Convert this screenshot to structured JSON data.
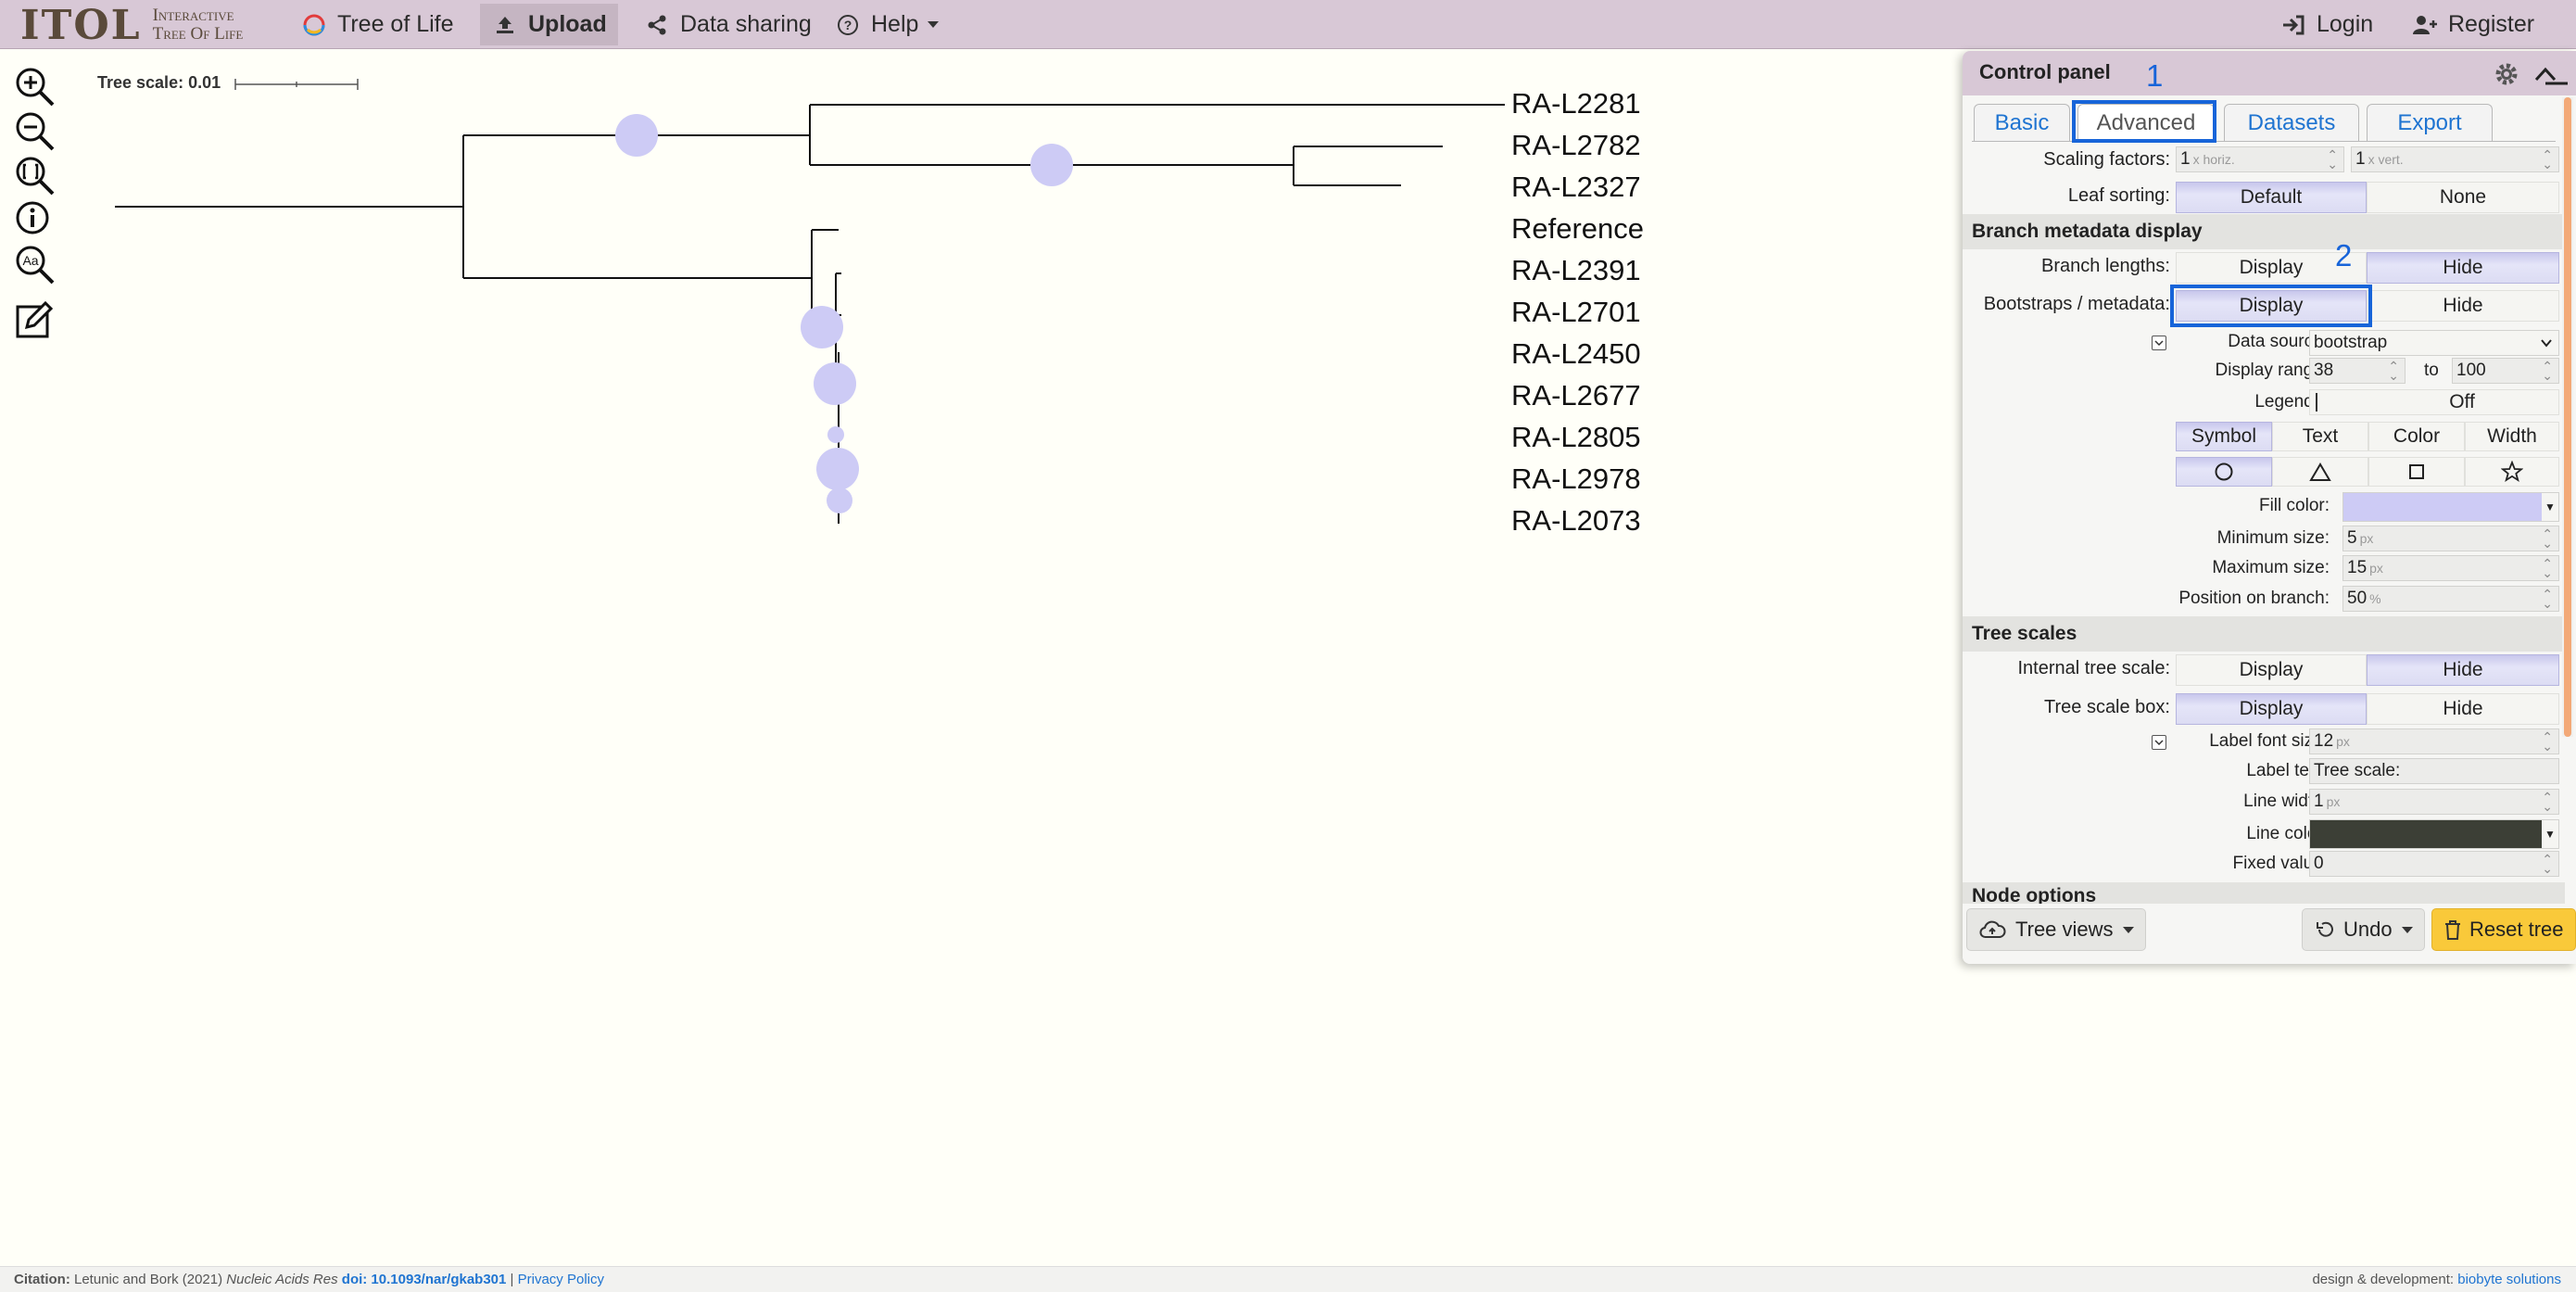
{
  "app": {
    "logo_main": "ITOL",
    "logo_sub_1": "Interactive",
    "logo_sub_2": "Tree Of Life"
  },
  "nav": {
    "tree_of_life": "Tree of Life",
    "upload": "Upload",
    "data_sharing": "Data sharing",
    "help": "Help",
    "login": "Login",
    "register": "Register"
  },
  "toolbar": {
    "icons": [
      "zoom-in-icon",
      "zoom-out-icon",
      "fit-to-screen-icon",
      "info-icon",
      "font-size-icon",
      "edit-icon"
    ]
  },
  "tree": {
    "scale_label": "Tree scale: 0.01",
    "leaves": [
      "RA-L2281",
      "RA-L2782",
      "RA-L2327",
      "Reference",
      "RA-L2391",
      "RA-L2701",
      "RA-L2450",
      "RA-L2677",
      "RA-L2805",
      "RA-L2978",
      "RA-L2073"
    ],
    "bootstrap_symbol_color": "#cdcbf5"
  },
  "control_panel": {
    "title": "Control panel",
    "tabs": [
      "Basic",
      "Advanced",
      "Datasets",
      "Export"
    ],
    "active_tab": "Advanced",
    "annotation_1": "1",
    "annotation_2": "2",
    "scaling_factors": {
      "label": "Scaling factors:",
      "horiz_value": "1",
      "horiz_unit": "x horiz.",
      "vert_value": "1",
      "vert_unit": "x vert."
    },
    "leaf_sorting": {
      "label": "Leaf sorting:",
      "options": [
        "Default",
        "None"
      ],
      "selected": "Default"
    },
    "branch_metadata": {
      "heading": "Branch metadata display",
      "branch_lengths_label": "Branch lengths:",
      "branch_lengths_options": [
        "Display",
        "Hide"
      ],
      "branch_lengths_selected": "Hide",
      "bootstraps_label": "Bootstraps / metadata:",
      "bootstraps_options": [
        "Display",
        "Hide"
      ],
      "bootstraps_selected": "Display",
      "data_source_label": "Data source:",
      "data_source_value": "bootstrap",
      "display_range_label": "Display range:",
      "display_range_min": "38",
      "display_range_to": "to",
      "display_range_max": "100",
      "legend_label": "Legend:",
      "legend_value": "Off",
      "style_tabs": [
        "Symbol",
        "Text",
        "Color",
        "Width"
      ],
      "style_selected": "Symbol",
      "symbols": [
        "circle-icon",
        "triangle-icon",
        "square-icon",
        "star-icon"
      ],
      "symbol_selected": "circle-icon",
      "fill_color_label": "Fill color:",
      "fill_color": "#cdcbf5",
      "min_size_label": "Minimum size:",
      "min_size_value": "5",
      "max_size_label": "Maximum size:",
      "max_size_value": "15",
      "position_label": "Position on branch:",
      "position_value": "50",
      "px_unit": "px",
      "pct_unit": "%"
    },
    "tree_scales": {
      "heading": "Tree scales",
      "internal_label": "Internal tree scale:",
      "internal_options": [
        "Display",
        "Hide"
      ],
      "internal_selected": "Hide",
      "box_label": "Tree scale box:",
      "box_options": [
        "Display",
        "Hide"
      ],
      "box_selected": "Display",
      "label_font_size_label": "Label font size:",
      "label_font_size_value": "12",
      "label_text_label": "Label text:",
      "label_text_value": "Tree scale:",
      "line_width_label": "Line width:",
      "line_width_value": "1",
      "line_color_label": "Line color:",
      "line_color": "#3c3f36",
      "fixed_value_label": "Fixed value:",
      "fixed_value_value": "0"
    },
    "node_options_heading": "Node options",
    "footer": {
      "tree_views": "Tree views",
      "undo": "Undo",
      "reset_tree": "Reset tree"
    }
  },
  "footer": {
    "citation_label": "Citation:",
    "citation_authors": "Letunic and Bork (2021)",
    "citation_journal": "Nucleic Acids Res",
    "citation_doi": "doi: 10.1093/nar/gkab301",
    "separator": "|",
    "privacy_policy": "Privacy Policy",
    "design_credit": "design & development:",
    "design_company": "biobyte solutions"
  }
}
